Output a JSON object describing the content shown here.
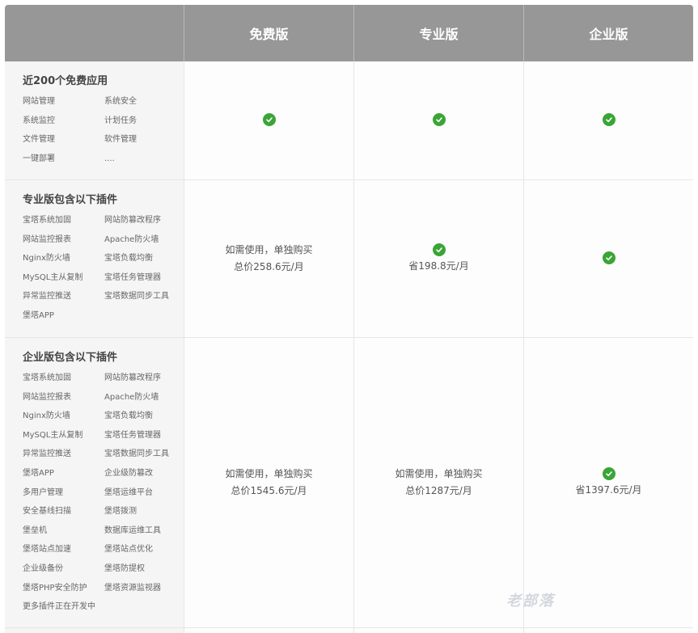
{
  "header": {
    "columns": [
      "免费版",
      "专业版",
      "企业版"
    ]
  },
  "rows": [
    {
      "title": "近200个免费应用",
      "features": [
        "网站管理",
        "系统安全",
        "系统监控",
        "计划任务",
        "文件管理",
        "软件管理",
        "一键部署",
        "...."
      ],
      "free": {
        "check": true,
        "lines": []
      },
      "pro": {
        "check": true,
        "lines": []
      },
      "ent": {
        "check": true,
        "lines": []
      }
    },
    {
      "title": "专业版包含以下插件",
      "features": [
        "宝塔系统加固",
        "网站防篡改程序",
        "网站监控报表",
        "Apache防火墙",
        "Nginx防火墙",
        "宝塔负载均衡",
        "MySQL主从复制",
        "宝塔任务管理器",
        "异常监控推送",
        "宝塔数据同步工具",
        "堡塔APP"
      ],
      "free": {
        "check": false,
        "lines": [
          "如需使用，单独购买",
          "总价258.6元/月"
        ]
      },
      "pro": {
        "check": true,
        "lines": [
          "省198.8元/月"
        ]
      },
      "ent": {
        "check": true,
        "lines": []
      }
    },
    {
      "title": "企业版包含以下插件",
      "features": [
        "宝塔系统加固",
        "网站防篡改程序",
        "网站监控报表",
        "Apache防火墙",
        "Nginx防火墙",
        "宝塔负载均衡",
        "MySQL主从复制",
        "宝塔任务管理器",
        "异常监控推送",
        "宝塔数据同步工具",
        "堡塔APP",
        "企业级防篡改",
        "多用户管理",
        "堡塔运维平台",
        "安全基线扫描",
        "堡塔拨测",
        "堡垒机",
        "数据库运维工具",
        "堡塔站点加速",
        "堡塔站点优化",
        "企业级备份",
        "堡塔防提权",
        "堡塔PHP安全防护",
        "堡塔资源监视器",
        "更多插件正在开发中"
      ],
      "free": {
        "check": false,
        "lines": [
          "如需使用，单独购买",
          "总价1545.6元/月"
        ]
      },
      "pro": {
        "check": false,
        "lines": [
          "如需使用，单独购买",
          "总价1287元/月"
        ]
      },
      "ent": {
        "check": true,
        "lines": [
          "省1397.6元/月"
        ]
      }
    }
  ],
  "watermark": "老部落",
  "colors": {
    "header_bg": "#979797",
    "check": "#3aa536",
    "feature_bg": "#f5f5f5"
  }
}
